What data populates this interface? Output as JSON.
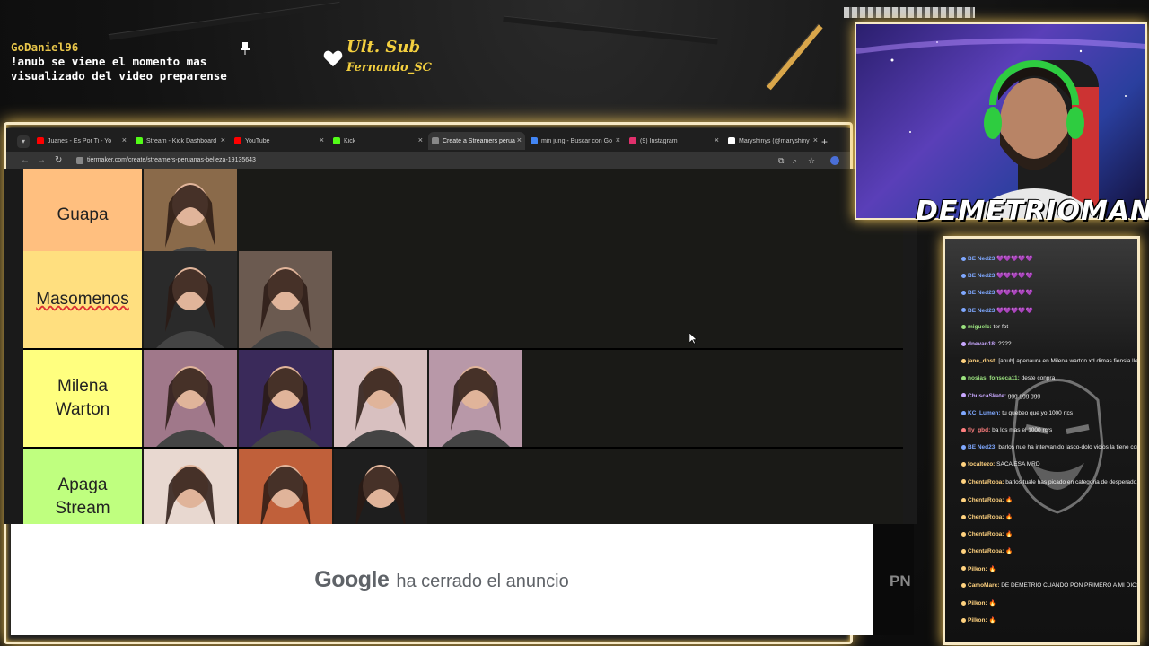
{
  "overlay": {
    "chat_user": "GoDaniel96",
    "chat_message": "!anub se viene el momento mas visualizado del video preparense",
    "last_sub_title": "Ult. Sub",
    "last_sub_name": "Fernando_SC",
    "streamer_name": "DEMETRIOMAN..."
  },
  "browser": {
    "tabs": [
      {
        "label": "Juanes - Es Por Ti - Yo",
        "favicon": "youtube-icon",
        "color": "#ff0000"
      },
      {
        "label": "Stream - Kick Dashboard",
        "favicon": "kick-icon",
        "color": "#53fc18"
      },
      {
        "label": "YouTube",
        "favicon": "youtube-icon",
        "color": "#ff0000"
      },
      {
        "label": "Kick",
        "favicon": "kick-icon",
        "color": "#53fc18"
      },
      {
        "label": "Create a Streamers perua",
        "favicon": "tiermaker-icon",
        "color": "#888888",
        "active": true
      },
      {
        "label": "min jung - Buscar con Go",
        "favicon": "google-icon",
        "color": "#4285f4"
      },
      {
        "label": "(9) Instagram",
        "favicon": "instagram-icon",
        "color": "#e1306c"
      },
      {
        "label": "Maryshinys (@maryshiny",
        "favicon": "tiktok-icon",
        "color": "#ffffff"
      }
    ],
    "url": "tiermaker.com/create/streamers-peruanas-belleza-19135643"
  },
  "tiers": [
    {
      "label": "Guapa",
      "color": "#ffbf7f",
      "thumbs": 1
    },
    {
      "label": "Masomenos",
      "color": "#ffdf7f",
      "thumbs": 2
    },
    {
      "label": "Milena\nWarton",
      "color": "#ffff7f",
      "thumbs": 4
    },
    {
      "label": "Apaga\nStream",
      "color": "#bfff7f",
      "thumbs": 3
    }
  ],
  "ad": {
    "brand": "Google",
    "message": "ha cerrado el anuncio",
    "side_text": "PN"
  },
  "chat": {
    "messages": [
      {
        "user": "BE Ned23",
        "text": "💜💜💜💜💜",
        "color": "#7fa8ff"
      },
      {
        "user": "BE Ned23",
        "text": "💜💜💜💜💜",
        "color": "#7fa8ff"
      },
      {
        "user": "BE Ned23",
        "text": "💜💜💜💜💜",
        "color": "#7fa8ff"
      },
      {
        "user": "BE Ned23",
        "text": "💜💜💜💜💜",
        "color": "#7fa8ff"
      },
      {
        "user": "miguelc:",
        "text": "ter fot",
        "color": "#9be27f"
      },
      {
        "user": "dnevan18:",
        "text": "????",
        "color": "#c9a8ff"
      },
      {
        "user": "jane_dost:",
        "text": "[anub] apenaura en Milena warton xd dimas fiensia llegado, seacamonacr a Demetrio",
        "color": "#ffd27f"
      },
      {
        "user": "nosias_fonseca11:",
        "text": "deste conpra",
        "color": "#9be27f"
      },
      {
        "user": "ChuscaSkate:",
        "text": "ggg ggg ggg",
        "color": "#c9a8ff"
      },
      {
        "user": "KC_Lumen:",
        "text": "tu quebeo que yo 1000 rtcs",
        "color": "#7fa8ff"
      },
      {
        "user": "fly_gbd:",
        "text": "ba los mas el 1000 rcrs",
        "color": "#ff7f7f"
      },
      {
        "user": "BE Ned23:",
        "text": "barlos nue ha intervanido lasco-dolo vicios la tiene con es dossa tormiga",
        "color": "#7fa8ff"
      },
      {
        "user": "focaltezo:",
        "text": "SACA ESA MRD",
        "color": "#ffd27f"
      },
      {
        "user": "ChentaRoba:",
        "text": "barlos tuale has picado en categoria de desperado, remoradio",
        "color": "#ffd27f"
      },
      {
        "user": "ChentaRoba:",
        "text": "🔥",
        "color": "#ffd27f"
      },
      {
        "user": "ChentaRoba:",
        "text": "🔥",
        "color": "#ffd27f"
      },
      {
        "user": "ChentaRoba:",
        "text": "🔥",
        "color": "#ffd27f"
      },
      {
        "user": "ChentaRoba:",
        "text": "🔥",
        "color": "#ffd27f"
      },
      {
        "user": "Pilkon:",
        "text": "🔥",
        "color": "#ffd27f"
      },
      {
        "user": "CamoMarc:",
        "text": "DE DEMETRIO CUANDO PON PRIMERO A MI DIOSA JAPERUANA",
        "color": "#ffd27f"
      },
      {
        "user": "Pilkon:",
        "text": "🔥",
        "color": "#ffd27f"
      },
      {
        "user": "Pilkon:",
        "text": "🔥",
        "color": "#ffd27f"
      }
    ]
  }
}
